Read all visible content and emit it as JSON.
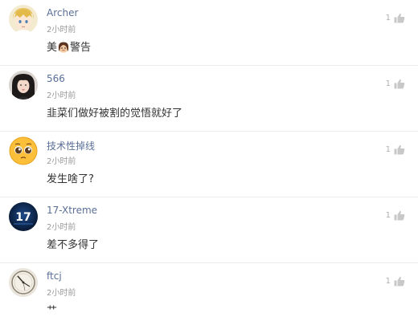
{
  "comments": [
    {
      "username": "Archer",
      "time": "2小时前",
      "content_before": "美",
      "content_emoji": "crying-face-emoji",
      "content_after": "警告",
      "likes": "1",
      "avatar": "avatar-anime-blond"
    },
    {
      "username": "566",
      "time": "2小时前",
      "content": "韭菜们做好被割的觉悟就好了",
      "likes": "1",
      "avatar": "avatar-portrait-dark-hair"
    },
    {
      "username": "技术性掉线",
      "time": "2小时前",
      "content": "发生啥了?",
      "likes": "1",
      "avatar": "avatar-pleading-emoji"
    },
    {
      "username": "17-Xtreme",
      "time": "2小时前",
      "content": "差不多得了",
      "likes": "1",
      "avatar": "avatar-17-logo",
      "avatar_text": "17"
    },
    {
      "username": "ftcj",
      "time": "2小时前",
      "content": "艹",
      "likes": "1",
      "avatar": "avatar-clock"
    }
  ],
  "colors": {
    "username": "#5a6f97",
    "time": "#9a9a9a",
    "content": "#333333",
    "likes": "#b0b0b0",
    "divider": "#ececec"
  },
  "icons": {
    "like": "thumbs-up-icon"
  }
}
